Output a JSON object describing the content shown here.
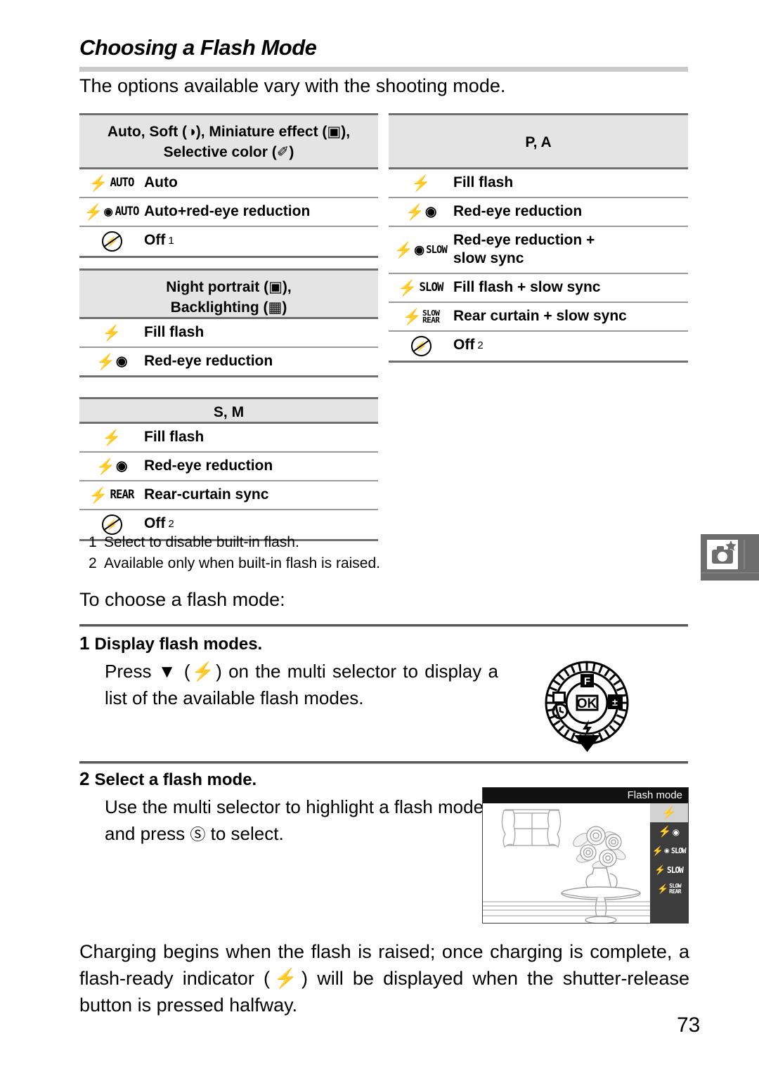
{
  "heading": {
    "title": "Choosing a Flash Mode",
    "intro": "The options available vary with the shooting mode."
  },
  "tables": [
    {
      "id": "auto-soft-miniature-selective",
      "header": "Auto, Soft (ⓘ), Miniature effect (⌘), Selective color (✎)",
      "header_line1": "Auto, Soft (\u0000), Miniature effect (\u0000),",
      "header_line2": "Selective color (\u0000)",
      "rows": [
        {
          "icon": "flash-auto-icon",
          "label": "Auto",
          "note": ""
        },
        {
          "icon": "flash-auto-redeye-icon",
          "label": "Auto+red-eye reduction",
          "note": ""
        },
        {
          "icon": "flash-off-icon",
          "label": "Off",
          "note": "1"
        }
      ]
    },
    {
      "id": "night-portrait-backlighting",
      "header_line1": "Night portrait (\u0000),",
      "header_line2": "Backlighting (\u0000)",
      "rows": [
        {
          "icon": "flash-fill-icon",
          "label": "Fill flash",
          "note": ""
        },
        {
          "icon": "flash-redeye-icon",
          "label": "Red-eye reduction",
          "note": ""
        }
      ]
    },
    {
      "id": "s-m",
      "header_line1": "S, M",
      "header_line2": "",
      "rows": [
        {
          "icon": "flash-fill-icon",
          "label": "Fill flash",
          "note": ""
        },
        {
          "icon": "flash-redeye-icon",
          "label": "Red-eye reduction",
          "note": ""
        },
        {
          "icon": "flash-rear-icon",
          "label": "Rear-curtain sync",
          "note": ""
        },
        {
          "icon": "flash-off-icon",
          "label": "Off",
          "note": "2"
        }
      ]
    },
    {
      "id": "p-a",
      "header_line1": "P, A",
      "header_line2": "",
      "rows": [
        {
          "icon": "flash-fill-icon",
          "label": "Fill flash",
          "note": ""
        },
        {
          "icon": "flash-redeye-icon",
          "label": "Red-eye reduction",
          "note": ""
        },
        {
          "icon": "flash-redeye-slow-icon",
          "label": "Red-eye reduction + slow sync",
          "note": ""
        },
        {
          "icon": "flash-slow-icon",
          "label": "Fill flash + slow sync",
          "note": ""
        },
        {
          "icon": "flash-slow-rear-icon",
          "label": "Rear curtain + slow sync",
          "note": ""
        },
        {
          "icon": "flash-off-icon",
          "label": "Off",
          "note": "2"
        }
      ]
    }
  ],
  "footnotes": [
    {
      "num": "1",
      "text": "Select to disable built-in flash."
    },
    {
      "num": "2",
      "text": "Available only when built-in flash is raised."
    }
  ],
  "lead_in": "To choose a flash mode:",
  "steps": [
    {
      "num": "1",
      "title": "Display flash modes.",
      "body": "Press ▼ (⚡) on the multi selector to display a list of the available flash modes."
    },
    {
      "num": "2",
      "title": "Select a flash mode.",
      "body": "Use the multi selector to highlight a flash mode and press Ⓚ to select."
    }
  ],
  "multi_selector": {
    "center_label": "OK",
    "top_label": "F",
    "right_icon": "exposure-compensation-icon",
    "left_icon": "release-mode-icon",
    "left_lower_icon": "self-timer-icon",
    "bottom_icon": "flash-icon"
  },
  "lcd": {
    "title": "Flash mode",
    "items": [
      {
        "icon": "flash-fill-icon",
        "selected": true
      },
      {
        "icon": "flash-redeye-icon",
        "selected": false
      },
      {
        "icon": "flash-redeye-slow-icon",
        "selected": false
      },
      {
        "icon": "flash-slow-icon",
        "selected": false
      },
      {
        "icon": "flash-slow-rear-icon",
        "selected": false
      }
    ],
    "scene": "window-flowers-vase-table"
  },
  "marker_tab": {
    "icon": "camera-star-icon"
  },
  "closing_paragraph": "Charging begins when the flash is raised; once charging is complete, a flash-ready indicator (⚡) will be displayed when the shutter-release button is pressed halfway.",
  "page_number": "73",
  "colors": {
    "header_bg": "#e4e4e4",
    "rule_dark": "#6f6f6f",
    "rule_light": "#9a9a9a",
    "title_rule": "#c9c9c9",
    "tab_bg": "#6d6d6d",
    "lcd_bar": "#111111",
    "lcd_side": "#3c3c3c",
    "lcd_selected": "#d2d2d2"
  }
}
